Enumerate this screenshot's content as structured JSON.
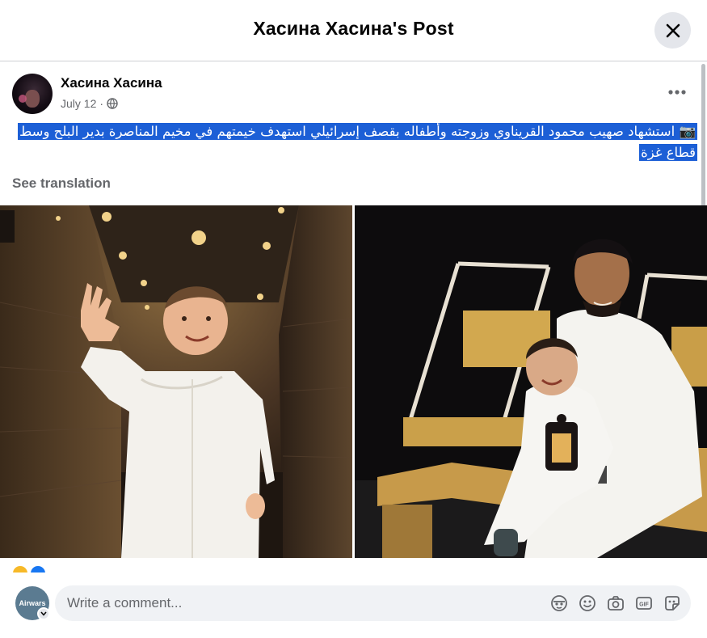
{
  "header": {
    "title": "Хасина Хасина's Post",
    "close_icon": "close-icon"
  },
  "post": {
    "author": "Хасина Хасина",
    "date": "July 12",
    "separator": "·",
    "privacy_icon": "globe-icon",
    "text": "📷 استشهاد صهيب محمود القريناوي وزوجته وأطفاله بقصف إسرائيلي استهدف خيمتهم في مخيم المناصرة بدير البلح وسط قطاع غزة",
    "see_translation": "See translation",
    "more_icon": "more-options-icon",
    "photos": [
      "photo-child-waving",
      "photo-father-and-child"
    ]
  },
  "comment": {
    "avatar_text": "Airwars",
    "placeholder": "Write a comment...",
    "icons": [
      "avatar-sticker-icon",
      "emoji-icon",
      "camera-icon",
      "gif-icon",
      "sticker-icon"
    ]
  },
  "colors": {
    "highlight": "#1c5fd6",
    "secondary_text": "#65676b",
    "field_bg": "#f0f2f5"
  }
}
